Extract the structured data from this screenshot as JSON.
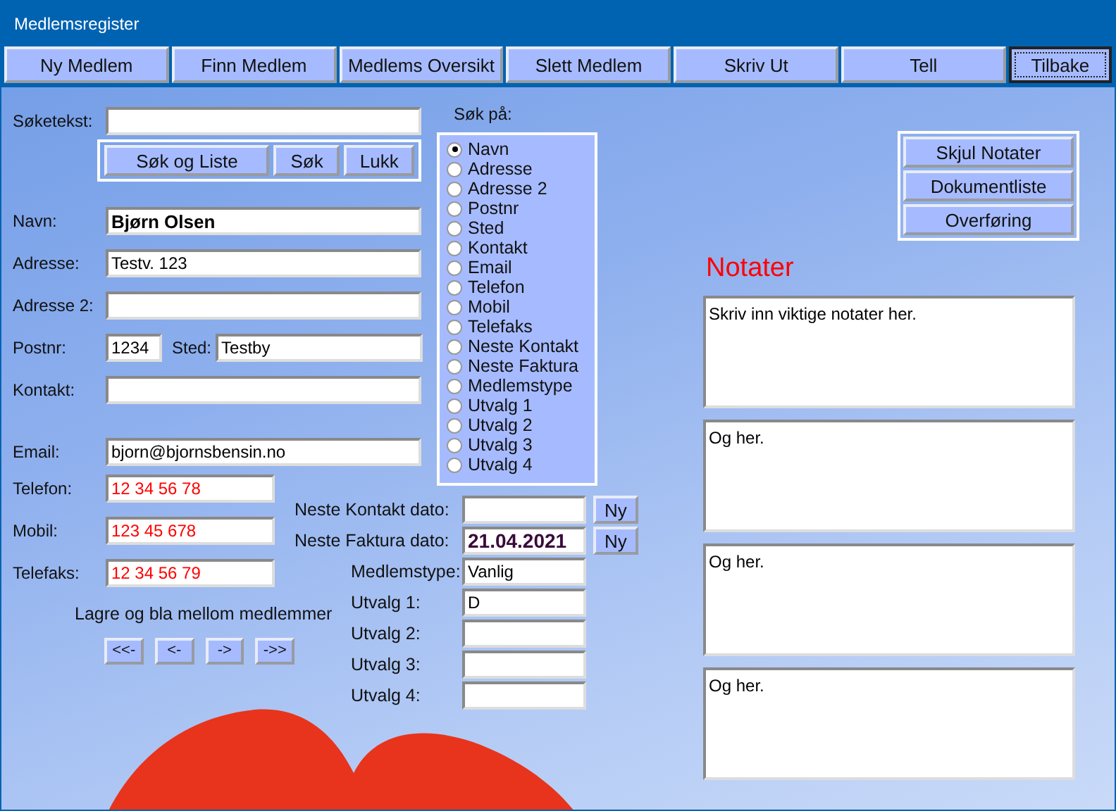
{
  "window": {
    "title": "Medlemsregister"
  },
  "toolbar": [
    {
      "label": "Ny Medlem",
      "focused": false
    },
    {
      "label": "Finn Medlem",
      "focused": false
    },
    {
      "label": "Medlems Oversikt",
      "focused": false
    },
    {
      "label": "Slett Medlem",
      "focused": false
    },
    {
      "label": "Skriv Ut",
      "focused": false
    },
    {
      "label": "Tell",
      "focused": false
    },
    {
      "label": "Tilbake",
      "focused": true
    }
  ],
  "search": {
    "label": "Søketekst:",
    "buttons": [
      "Søk og Liste",
      "Søk",
      "Lukk"
    ]
  },
  "fields": [
    {
      "label": "Navn:",
      "value": "Bjørn Olsen",
      "kind": "name"
    },
    {
      "label": "Adresse:",
      "value": "Testv. 123",
      "kind": "text"
    },
    {
      "label": "Adresse 2:",
      "kind": "text"
    },
    {
      "label": "Postnr:",
      "value": "1234",
      "kind": "text",
      "extra_label": "Sted:",
      "extra_value": "Testby"
    },
    {
      "label": "Kontakt:",
      "kind": "text"
    },
    {
      "label": "Email:",
      "value": "bjorn@bjornsbensin.no",
      "kind": "text"
    }
  ],
  "phones": [
    {
      "label": "Telefon:",
      "value": "12 34 56 78",
      "kind": "phone"
    },
    {
      "label": "Mobil:",
      "value": "123 45 678",
      "kind": "phone"
    },
    {
      "label": "Telefaks:",
      "value": "12 34 56 79",
      "kind": "phone"
    }
  ],
  "navigation": {
    "caption": "Lagre og bla mellom medlemmer",
    "buttons": [
      "<<-",
      "<-",
      "->",
      "->>"
    ]
  },
  "search_on": {
    "label": "Søk på:",
    "options": [
      {
        "label": "Navn",
        "selected": true
      },
      {
        "label": "Adresse",
        "selected": false
      },
      {
        "label": "Adresse 2",
        "selected": false
      },
      {
        "label": "Postnr",
        "selected": false
      },
      {
        "label": "Sted",
        "selected": false
      },
      {
        "label": "Kontakt",
        "selected": false
      },
      {
        "label": "Email",
        "selected": false
      },
      {
        "label": "Telefon",
        "selected": false
      },
      {
        "label": "Mobil",
        "selected": false
      },
      {
        "label": "Telefaks",
        "selected": false
      },
      {
        "label": "Neste Kontakt",
        "selected": false
      },
      {
        "label": "Neste Faktura",
        "selected": false
      },
      {
        "label": "Medlemstype",
        "selected": false
      },
      {
        "label": "Utvalg 1",
        "selected": false
      },
      {
        "label": "Utvalg 2",
        "selected": false
      },
      {
        "label": "Utvalg 3",
        "selected": false
      },
      {
        "label": "Utvalg 4",
        "selected": false
      }
    ]
  },
  "dates": [
    {
      "label": "Neste Kontakt dato:",
      "button": "Ny"
    },
    {
      "label": "Neste Faktura dato:",
      "value": "21.04.2021",
      "button": "Ny"
    }
  ],
  "selections": [
    {
      "label": "Medlemstype:",
      "value": "Vanlig"
    },
    {
      "label": "Utvalg 1:",
      "value": "D"
    },
    {
      "label": "Utvalg 2:"
    },
    {
      "label": "Utvalg 3:"
    },
    {
      "label": "Utvalg 4:"
    }
  ],
  "side_buttons": [
    "Skjul Notater",
    "Dokumentliste",
    "Overføring"
  ],
  "notes": {
    "title": "Notater",
    "boxes": [
      "Skriv inn viktige notater her.",
      "Og her.",
      "Og her.",
      "Og her."
    ]
  }
}
